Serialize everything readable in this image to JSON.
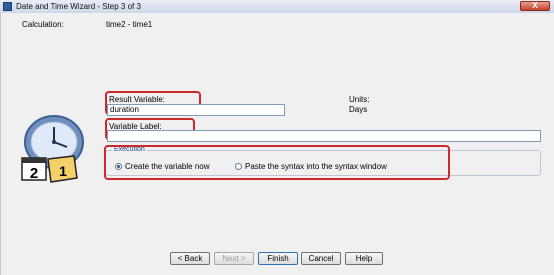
{
  "window": {
    "title": "Date and Time Wizard - Step 3 of 3",
    "close_glyph": "X"
  },
  "calculation": {
    "label": "Calculation:",
    "expression": "time2 - time1"
  },
  "result": {
    "label": "Result Variable:",
    "value": "duration"
  },
  "units": {
    "label": "Units:",
    "value": "Days"
  },
  "variable_label": {
    "label": "Variable Label:",
    "value": ""
  },
  "execution": {
    "title": "Execution",
    "options": [
      {
        "label": "Create the variable now",
        "selected": true
      },
      {
        "label": "Paste the syntax into the syntax window",
        "selected": false
      }
    ]
  },
  "buttons": {
    "back": "< Back",
    "next": "Next >",
    "finish": "Finish",
    "cancel": "Cancel",
    "help": "Help"
  },
  "illustration": {
    "calendar_left": "2",
    "calendar_right": "1"
  },
  "colors": {
    "highlight": "#cc2a2a",
    "panel": "#f0f0f0"
  }
}
